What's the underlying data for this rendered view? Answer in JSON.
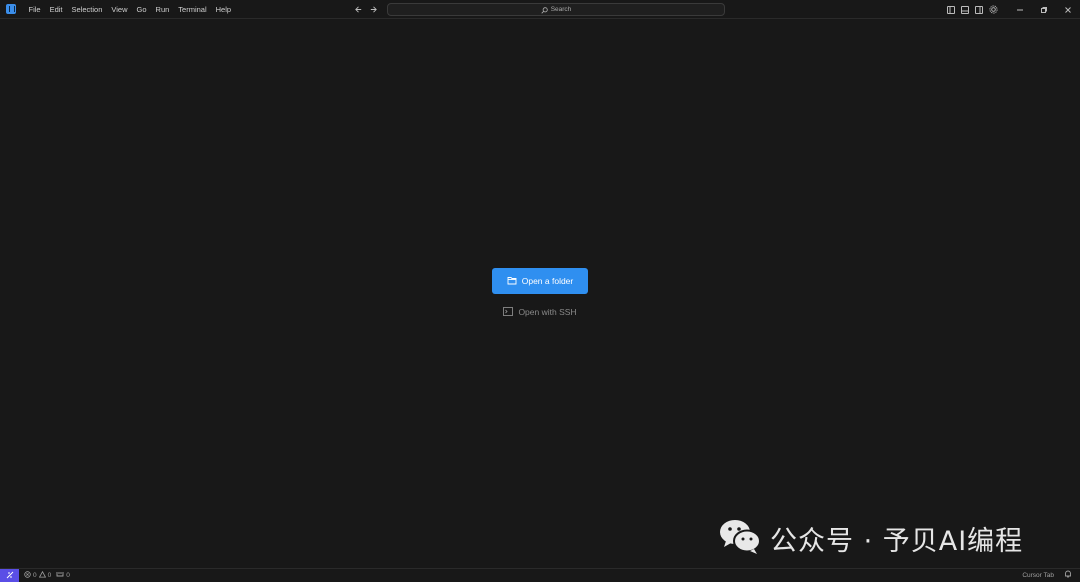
{
  "titlebar": {
    "menu": [
      "File",
      "Edit",
      "Selection",
      "View",
      "Go",
      "Run",
      "Terminal",
      "Help"
    ],
    "search_placeholder": "Search"
  },
  "welcome": {
    "open_folder_label": "Open a folder",
    "open_ssh_label": "Open with SSH"
  },
  "statusbar": {
    "errors": "0",
    "warnings": "0",
    "ports": "0",
    "cursor_tab": "Cursor Tab"
  },
  "watermark": {
    "text": "公众号 · 予贝AI编程"
  },
  "colors": {
    "background": "#181818",
    "accent": "#2f8ff0",
    "remote": "#5a4ee6"
  }
}
